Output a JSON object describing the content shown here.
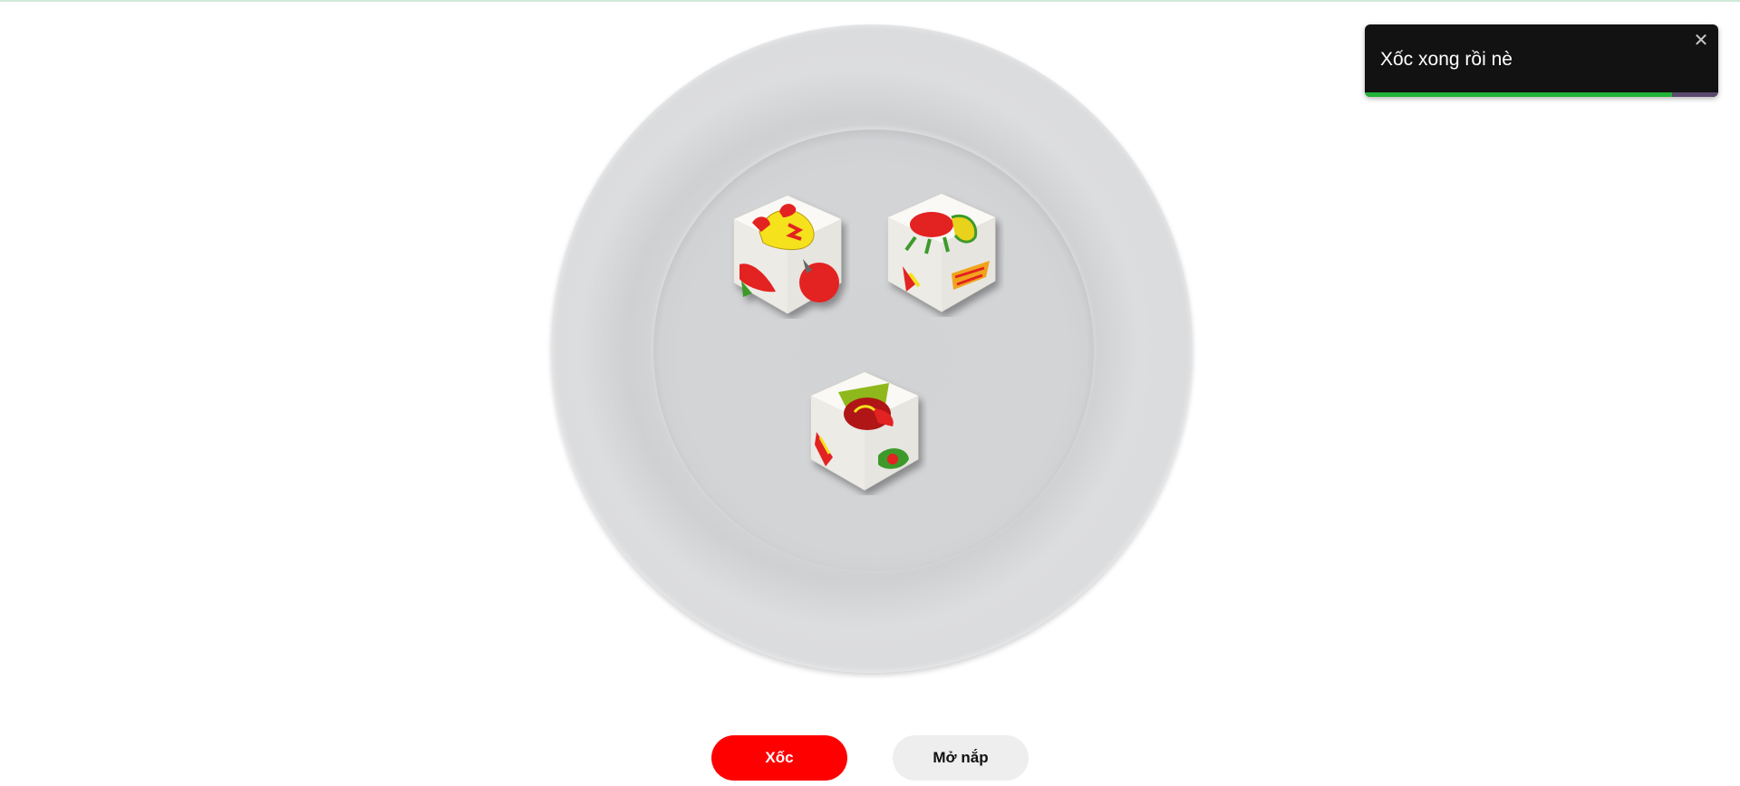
{
  "toast": {
    "message": "Xốc xong rồi nè",
    "close_icon": "close-icon",
    "progress": 0.87,
    "colors": {
      "background": "#121212",
      "progress": "#20b33a",
      "track": "#5b4a6e"
    }
  },
  "game": {
    "plate": "white-plate",
    "dice": [
      {
        "face": "rooster"
      },
      {
        "face": "shrimp"
      },
      {
        "face": "fish"
      }
    ]
  },
  "buttons": {
    "shake_label": "Xốc",
    "open_label": "Mở nắp"
  },
  "colors": {
    "accent": "#ff0000",
    "secondary_button": "#eeeeee"
  }
}
